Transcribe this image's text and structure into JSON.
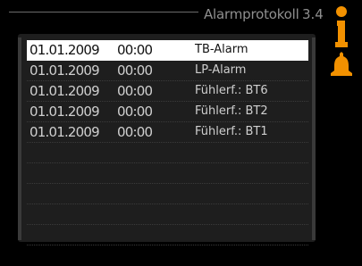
{
  "header": {
    "title": "Alarmprotokoll",
    "screen_id": "3.4"
  },
  "alarm_log": {
    "rows": [
      {
        "date": "01.01.2009",
        "time": "00:00",
        "alarm": "TB-Alarm"
      },
      {
        "date": "01.01.2009",
        "time": "00:00",
        "alarm": "LP-Alarm"
      },
      {
        "date": "01.01.2009",
        "time": "00:00",
        "alarm": "Fühlerf.: BT6"
      },
      {
        "date": "01.01.2009",
        "time": "00:00",
        "alarm": "Fühlerf.: BT2"
      },
      {
        "date": "01.01.2009",
        "time": "00:00",
        "alarm": "Fühlerf.: BT1"
      }
    ],
    "selected_index": 0
  },
  "icons": {
    "info": "info-icon",
    "warning": "warning-icon",
    "accent_color": "#f29100"
  }
}
